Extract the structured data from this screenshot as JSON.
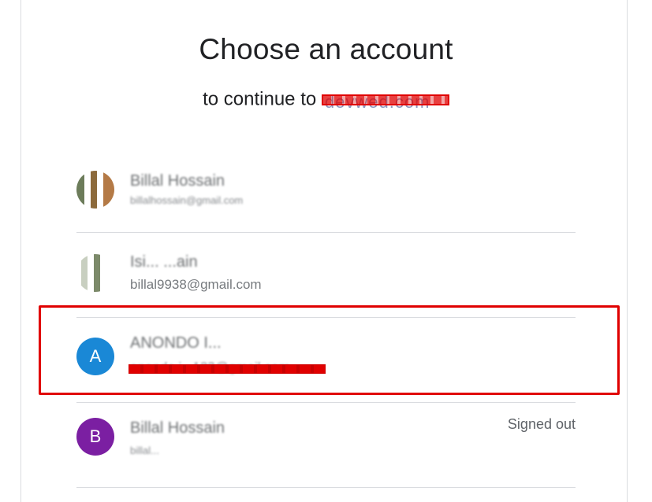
{
  "header": {
    "title": "Choose an account",
    "subtitle_prefix": "to continue to",
    "site": "devwed.com"
  },
  "accounts": [
    {
      "avatar": "photo",
      "name": "Billal Hossain",
      "email": "billalhossain@gmail.com",
      "status": ""
    },
    {
      "avatar": "photo",
      "name": "Isi... ...ain",
      "email": "billal9938@gmail.com",
      "status": ""
    },
    {
      "avatar_letter": "A",
      "name": "ANONDO I...",
      "email": "anondo.i...123@gmail.com",
      "status": "",
      "avatar_color": "#1a88d6"
    },
    {
      "avatar_letter": "B",
      "name": "Billal Hossain",
      "email": "billal...",
      "status": "Signed out",
      "avatar_color": "#7b1fa2"
    }
  ],
  "colors": {
    "highlight": "#e00000",
    "divider": "#dadce0"
  }
}
